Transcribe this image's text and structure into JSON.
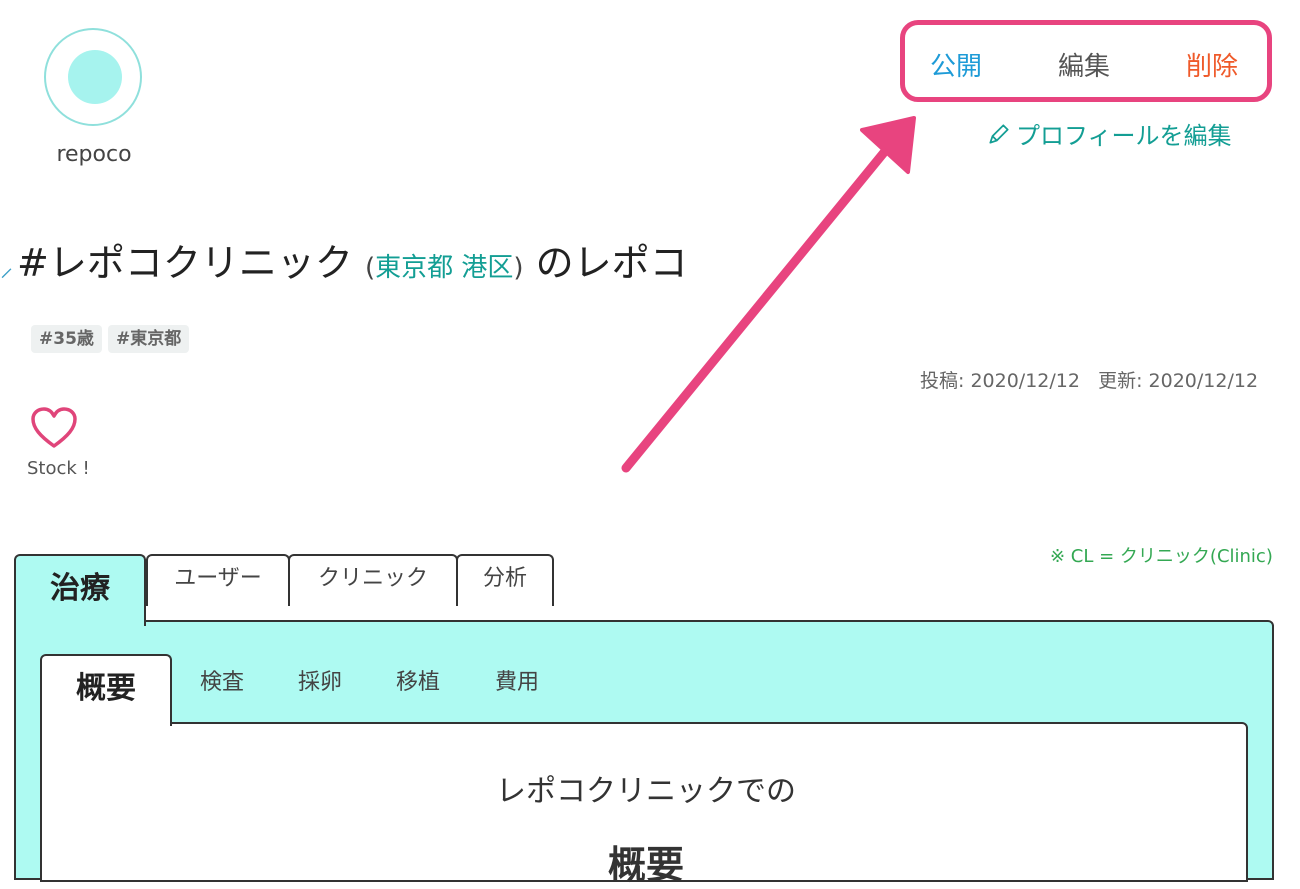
{
  "user": {
    "name": "repoco"
  },
  "actions": {
    "publish": "公開",
    "edit": "編集",
    "delete": "削除",
    "profile_edit": "プロフィールを編集"
  },
  "title": {
    "clinic": "#レポコクリニック",
    "paren_open": "(",
    "location": "東京都 港区",
    "paren_close": ")",
    "suffix": "のレポコ"
  },
  "tags": [
    "#35歳",
    "#東京都"
  ],
  "dates": {
    "posted": "投稿: 2020/12/12",
    "updated": "更新: 2020/12/12"
  },
  "stock": {
    "label": "Stock !"
  },
  "note": "※ CL = クリニック(Clinic)",
  "outer_tabs": [
    "治療",
    "ユーザー",
    "クリニック",
    "分析"
  ],
  "inner_tabs": [
    "概要",
    "検査",
    "採卵",
    "移植",
    "費用"
  ],
  "content": {
    "subtitle": "レポコクリニックでの",
    "heading": "概要"
  },
  "colors": {
    "accent_pink": "#e8447f",
    "teal": "#139e94",
    "panel": "#aefaf2"
  }
}
